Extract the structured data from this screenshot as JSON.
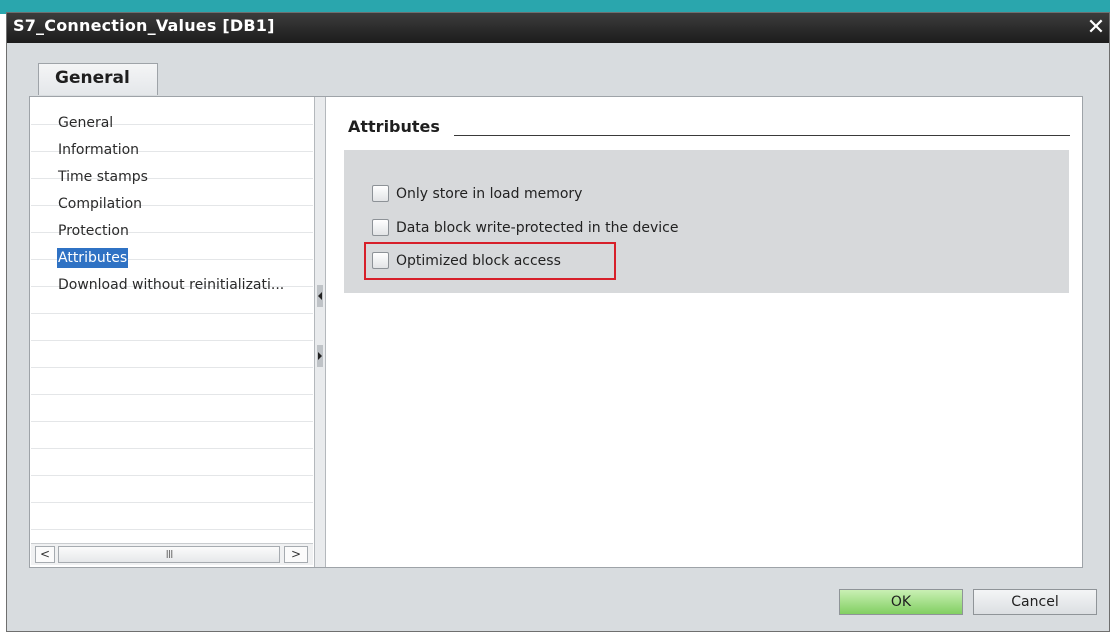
{
  "window": {
    "title": "S7_Connection_Values [DB1]",
    "close_glyph": "✕"
  },
  "tabs": [
    {
      "label": "General",
      "active": true
    }
  ],
  "nav": {
    "items": [
      {
        "label": "General",
        "selected": false
      },
      {
        "label": "Information",
        "selected": false
      },
      {
        "label": "Time stamps",
        "selected": false
      },
      {
        "label": "Compilation",
        "selected": false
      },
      {
        "label": "Protection",
        "selected": false
      },
      {
        "label": "Attributes",
        "selected": true
      },
      {
        "label": "Download without reinitializati...",
        "selected": false
      }
    ],
    "scrollbar": {
      "left_arrow": "<",
      "thumb_grip": "III",
      "right_arrow": ">"
    }
  },
  "attributes": {
    "title": "Attributes",
    "checkboxes": [
      {
        "label": "Only store in load memory",
        "checked": false
      },
      {
        "label": "Data block write-protected in the device",
        "checked": false
      },
      {
        "label": "Optimized block access",
        "checked": false,
        "highlighted": true
      }
    ]
  },
  "buttons": {
    "ok": "OK",
    "cancel": "Cancel"
  },
  "colors": {
    "selection": "#2f72c4",
    "highlight_border": "#d7202a",
    "ok_button": "#82cf62",
    "title_bar": "#1c1c1c"
  },
  "icons": {
    "close": "close-icon",
    "splitter_left": "collapse-left-icon",
    "splitter_right": "expand-right-icon"
  }
}
